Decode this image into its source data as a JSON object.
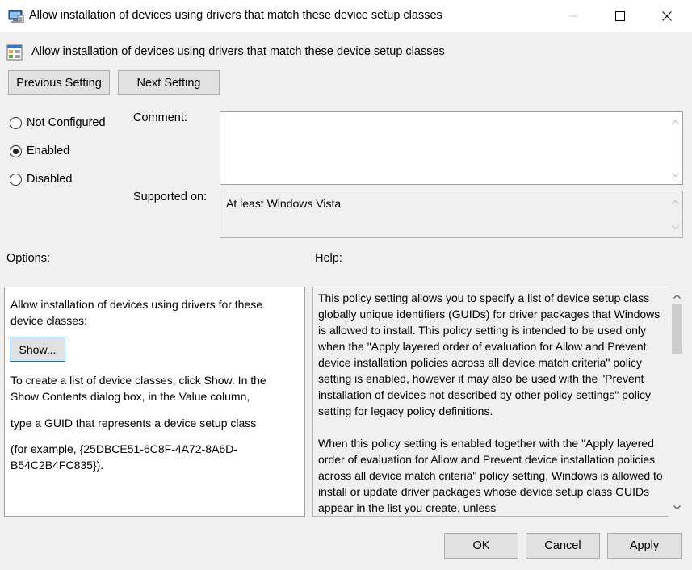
{
  "window": {
    "title": "Allow installation of devices using drivers that match these device setup classes",
    "icons": {
      "app": "policy-settings-icon",
      "minimize": "minimize-icon",
      "maximize": "maximize-icon",
      "close": "close-icon"
    }
  },
  "header": {
    "title": "Allow installation of devices using drivers that match these device setup classes",
    "icon": "policy-setting-icon"
  },
  "nav": {
    "previous_label": "Previous Setting",
    "next_label": "Next Setting"
  },
  "state": {
    "options": [
      {
        "label": "Not Configured",
        "checked": false
      },
      {
        "label": "Enabled",
        "checked": true
      },
      {
        "label": "Disabled",
        "checked": false
      }
    ]
  },
  "comment": {
    "label": "Comment:",
    "value": ""
  },
  "supported": {
    "label": "Supported on:",
    "value": "At least Windows Vista"
  },
  "options_panel": {
    "label": "Options:",
    "intro": "Allow installation of devices using drivers for these device classes:",
    "show_label": "Show...",
    "para1": "To create a list of device classes, click Show. In the Show Contents dialog box, in the Value column,",
    "para2": "type a GUID that represents a device setup class",
    "para3": "(for example, {25DBCE51-6C8F-4A72-8A6D-B54C2B4FC835})."
  },
  "help_panel": {
    "label": "Help:",
    "para1": "This policy setting allows you to specify a list of device setup class globally unique identifiers (GUIDs) for driver packages that Windows is allowed to install. This policy setting is intended to be used only when the \"Apply layered order of evaluation for Allow and Prevent device installation policies across all device match criteria\" policy setting is enabled, however it may also be used with the \"Prevent installation of devices not described by other policy settings\" policy setting for legacy policy definitions.",
    "para2": "When this policy setting is enabled together with the \"Apply layered order of evaluation for Allow and Prevent device installation policies across all device match criteria\" policy setting, Windows is allowed to install or update driver packages whose device setup class GUIDs appear in the list you create, unless"
  },
  "footer": {
    "ok_label": "OK",
    "cancel_label": "Cancel",
    "apply_label": "Apply"
  }
}
